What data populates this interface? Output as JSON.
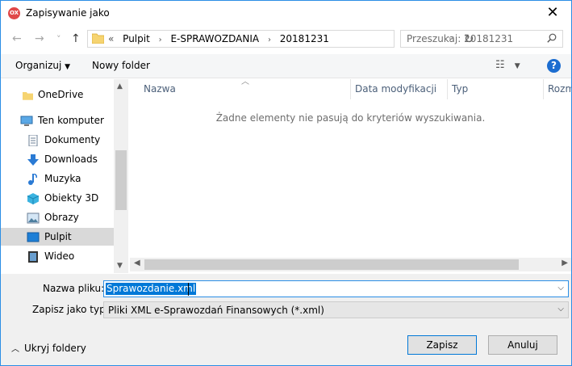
{
  "window": {
    "title": "Zapisywanie jako",
    "app_icon": "OX"
  },
  "nav": {
    "back": "←",
    "forward": "→",
    "recent": "˅",
    "up": "↑"
  },
  "address": {
    "prefix": "«",
    "crumbs": [
      "Pulpit",
      "E-SPRAWOZDANIA",
      "20181231"
    ],
    "separator": "›"
  },
  "search": {
    "placeholder": "Przeszukaj: 20181231"
  },
  "toolbar": {
    "organize": "Organizuj",
    "new_folder": "Nowy folder",
    "help": "?"
  },
  "sidebar": {
    "items": [
      {
        "label": "OneDrive",
        "icon": "folder-icon"
      },
      {
        "label": "Ten komputer",
        "icon": "computer-icon"
      },
      {
        "label": "Dokumenty",
        "icon": "document-icon"
      },
      {
        "label": "Downloads",
        "icon": "download-icon"
      },
      {
        "label": "Muzyka",
        "icon": "music-icon"
      },
      {
        "label": "Obiekty 3D",
        "icon": "cube-icon"
      },
      {
        "label": "Obrazy",
        "icon": "image-icon"
      },
      {
        "label": "Pulpit",
        "icon": "desktop-icon",
        "selected": true
      },
      {
        "label": "Wideo",
        "icon": "video-icon"
      }
    ]
  },
  "columns": [
    "Nazwa",
    "Data modyfikacji",
    "Typ",
    "Rozm"
  ],
  "empty_message": "Żadne elementy nie pasują do kryteriów wyszukiwania.",
  "form": {
    "filename_label": "Nazwa pliku:",
    "filename_value": "Sprawozdanie.xml",
    "filetype_label": "Zapisz jako typ:",
    "filetype_value": "Pliki XML e-Sprawozdań Finansowych (*.xml)"
  },
  "footer": {
    "hide_folders": "Ukryj foldery",
    "save": "Zapisz",
    "cancel": "Anuluj"
  },
  "colors": {
    "accent": "#0078d7",
    "selection": "#d9d9d9",
    "help": "#1c6dd0"
  }
}
